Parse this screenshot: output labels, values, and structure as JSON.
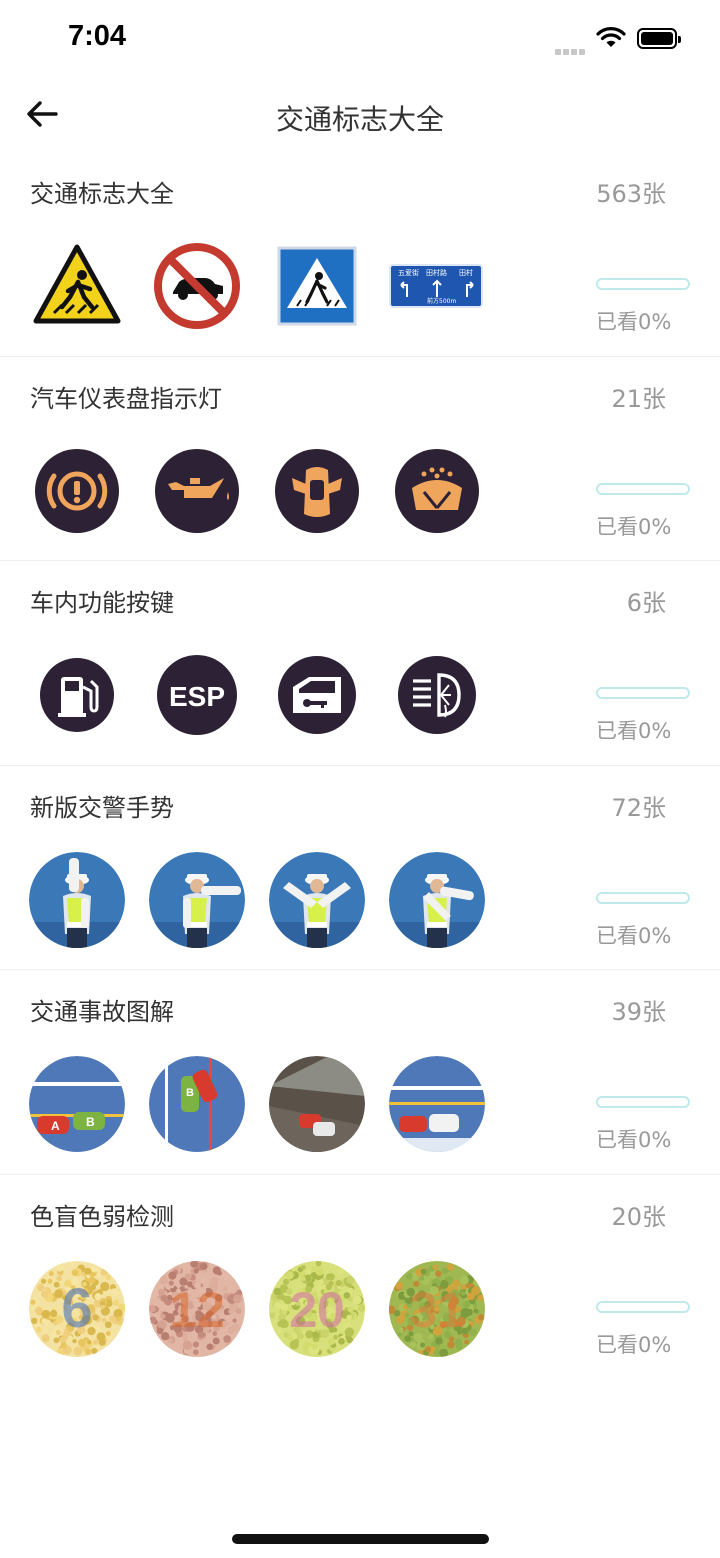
{
  "status": {
    "time": "7:04"
  },
  "nav": {
    "title": "交通标志大全"
  },
  "accent_color": "#6fd3d6",
  "sections": [
    {
      "title": "交通标志大全",
      "count": "563张",
      "viewed": "已看0%",
      "progress": 0,
      "icons": [
        "pedestrian-warning-sign-icon",
        "no-cars-sign-icon",
        "crosswalk-sign-icon",
        "direction-board-sign-icon"
      ],
      "sign_board": {
        "names": [
          "五爱街",
          "田村路",
          "田村"
        ],
        "distance": "前方500m"
      }
    },
    {
      "title": "汽车仪表盘指示灯",
      "count": "21张",
      "viewed": "已看0%",
      "progress": 0,
      "icons": [
        "parking-brake-warning-icon",
        "oil-pressure-warning-icon",
        "door-open-warning-icon",
        "washer-fluid-warning-icon"
      ]
    },
    {
      "title": "车内功能按键",
      "count": "6张",
      "viewed": "已看0%",
      "progress": 0,
      "icons": [
        "fuel-gauge-icon",
        "esp-button-icon",
        "door-lock-key-icon",
        "headlight-washer-icon"
      ],
      "esp_label": "ESP"
    },
    {
      "title": "新版交警手势",
      "count": "72张",
      "viewed": "已看0%",
      "progress": 0,
      "icons": [
        "police-stop-gesture-icon",
        "police-straight-gesture-icon",
        "police-left-turn-gesture-icon",
        "police-right-turn-gesture-icon"
      ]
    },
    {
      "title": "交通事故图解",
      "count": "39张",
      "viewed": "已看0%",
      "progress": 0,
      "icons": [
        "accident-diagram-1-icon",
        "accident-diagram-2-icon",
        "accident-diagram-3-icon",
        "accident-diagram-4-icon"
      ],
      "car_labels": [
        "A",
        "B"
      ]
    },
    {
      "title": "色盲色弱检测",
      "count": "20张",
      "viewed": "已看0%",
      "progress": 0,
      "icons": [
        "color-test-plate-6-icon",
        "color-test-plate-12-icon",
        "color-test-plate-20-icon",
        "color-test-plate-31-icon"
      ],
      "plate_numbers": [
        "6",
        "12",
        "20",
        "31"
      ]
    }
  ]
}
